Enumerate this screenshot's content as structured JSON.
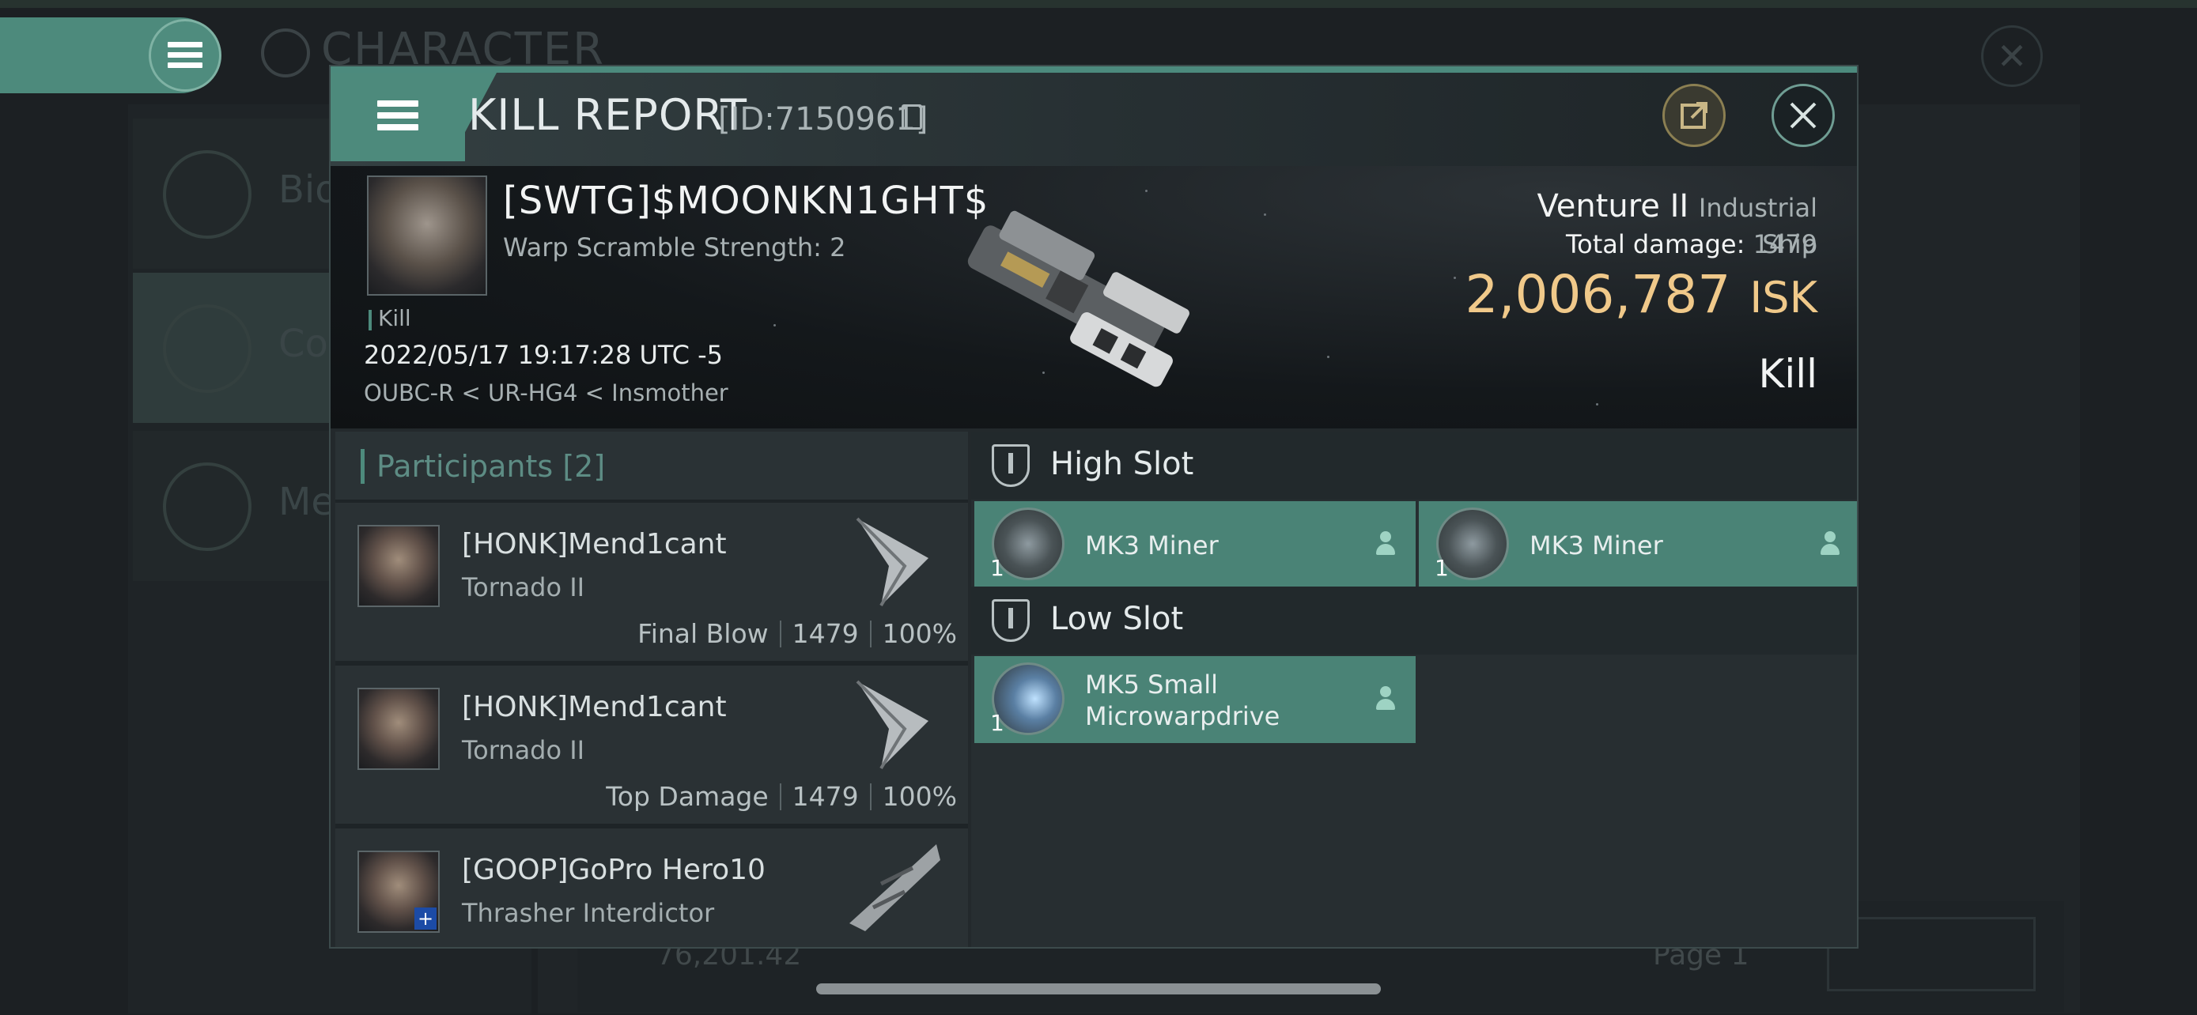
{
  "background": {
    "screen_title": "CHARACTER",
    "side_items": [
      "Bio",
      "Co",
      "Me"
    ],
    "balance": "76,201.42",
    "page_label": "Page 1"
  },
  "dialog": {
    "title": "KILL REPORT",
    "report_id": "[ID:7150961]",
    "icons": {
      "menu": "hamburger-icon",
      "share": "external-link-icon",
      "close": "close-icon",
      "copy": "copy-icon"
    },
    "accent_color": "#4d8a7c",
    "isk_color": "#f0c98a"
  },
  "victim": {
    "name": "[SWTG]$MOONKN1GHT$",
    "warp_scramble": "Warp Scramble Strength: 2",
    "tag": "Kill",
    "datetime": "2022/05/17 19:17:28 UTC -5",
    "location": "OUBC-R < UR-HG4 < Insmother",
    "ship_name": "Venture II",
    "ship_class": "Industrial Ship",
    "total_damage_label": "Total damage:",
    "total_damage": "1479",
    "isk_value": "2,006,787",
    "isk_unit": "ISK",
    "result": "Kill"
  },
  "participants": {
    "title": "Participants",
    "count": "[2]",
    "rows": [
      {
        "name": "[HONK]Mend1cant",
        "ship": "Tornado II",
        "role": "Final Blow",
        "damage": "1479",
        "percent": "100%"
      },
      {
        "name": "[HONK]Mend1cant",
        "ship": "Tornado II",
        "role": "Top Damage",
        "damage": "1479",
        "percent": "100%"
      },
      {
        "name": "[GOOP]GoPro Hero10",
        "ship": "Thrasher Interdictor"
      }
    ]
  },
  "slots": {
    "high": {
      "title": "High Slot",
      "modules": [
        {
          "name": "MK3 Miner",
          "qty": "1"
        },
        {
          "name": "MK3 Miner",
          "qty": "1"
        }
      ]
    },
    "low": {
      "title": "Low Slot",
      "modules": [
        {
          "name_line1": "MK5 Small",
          "name_line2": "Microwarpdrive",
          "qty": "1"
        }
      ]
    }
  }
}
